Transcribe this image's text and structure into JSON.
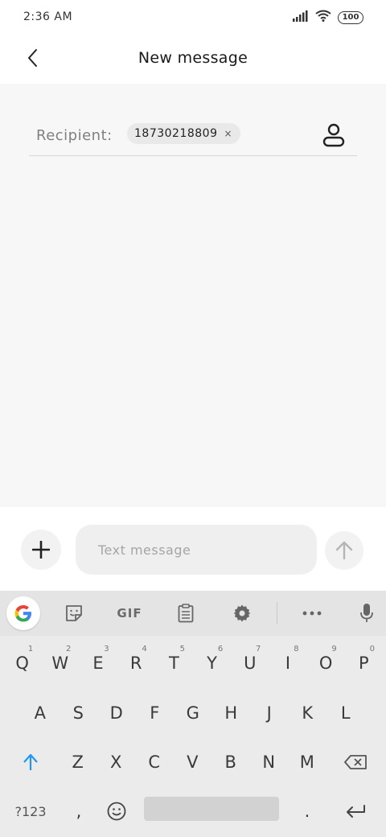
{
  "status_bar": {
    "time": "2:36 AM",
    "battery": "100"
  },
  "header": {
    "title": "New message"
  },
  "recipient": {
    "label": "Recipient:",
    "chip_value": "18730218809",
    "chip_close": "×"
  },
  "compose": {
    "placeholder": "Text message"
  },
  "keyboard": {
    "toolbar": {
      "gif": "GIF"
    },
    "row1": [
      {
        "label": "Q",
        "hint": "1"
      },
      {
        "label": "W",
        "hint": "2"
      },
      {
        "label": "E",
        "hint": "3"
      },
      {
        "label": "R",
        "hint": "4"
      },
      {
        "label": "T",
        "hint": "5"
      },
      {
        "label": "Y",
        "hint": "6"
      },
      {
        "label": "U",
        "hint": "7"
      },
      {
        "label": "I",
        "hint": "8"
      },
      {
        "label": "O",
        "hint": "9"
      },
      {
        "label": "P",
        "hint": "0"
      }
    ],
    "row2": [
      "A",
      "S",
      "D",
      "F",
      "G",
      "H",
      "J",
      "K",
      "L"
    ],
    "row3": [
      "Z",
      "X",
      "C",
      "V",
      "B",
      "N",
      "M"
    ],
    "row4": {
      "symbols": "?123",
      "comma": ",",
      "period": "."
    }
  },
  "colors": {
    "accent_shift": "#2196f3",
    "content_bg": "#f7f7f7",
    "keyboard_bg": "#ebebeb"
  }
}
